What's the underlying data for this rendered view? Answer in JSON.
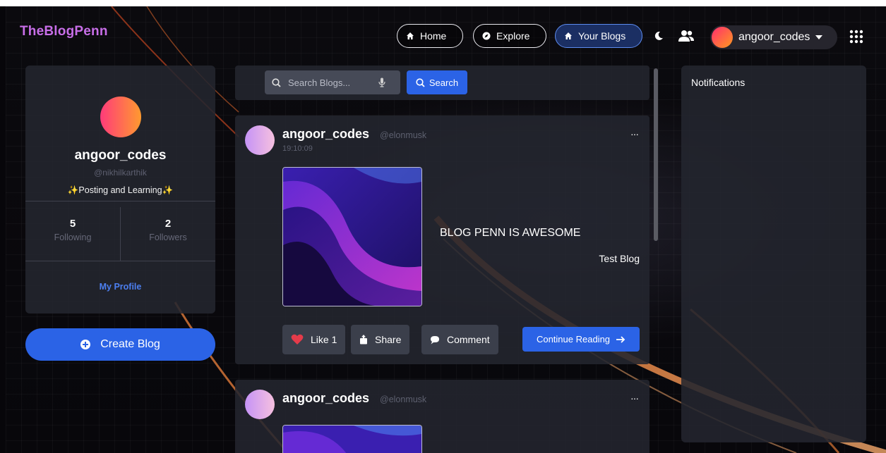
{
  "app": {
    "logo": "TheBlogPenn"
  },
  "nav": {
    "items": [
      {
        "label": "Home",
        "icon": "home-icon"
      },
      {
        "label": "Explore",
        "icon": "compass-icon"
      },
      {
        "label": "Your Blogs",
        "icon": "home-icon",
        "active": true
      }
    ],
    "user": {
      "username": "angoor_codes"
    }
  },
  "profile": {
    "name": "angoor_codes",
    "handle": "@nikhilkarthik",
    "bio": "✨Posting and Learning✨",
    "following_count": "5",
    "following_label": "Following",
    "followers_count": "2",
    "followers_label": "Followers",
    "link_label": "My Profile"
  },
  "create_button": {
    "label": "Create Blog"
  },
  "search": {
    "placeholder": "Search Blogs...",
    "button_label": "Search"
  },
  "posts": [
    {
      "author": "angoor_codes",
      "handle": "@elonmusk",
      "time": "19:10:09",
      "more": "···",
      "title": "BLOG PENN IS AWESOME",
      "subtitle": "Test Blog",
      "like_label": "Like 1",
      "share_label": "Share",
      "comment_label": "Comment",
      "continue_label": "Continue Reading"
    },
    {
      "author": "angoor_codes",
      "handle": "@elonmusk",
      "more": "···"
    }
  ],
  "notifications": {
    "title": "Notifications"
  },
  "colors": {
    "accent": "#2b63e6",
    "logo": "#c86ee8",
    "like": "#e53b4a"
  }
}
